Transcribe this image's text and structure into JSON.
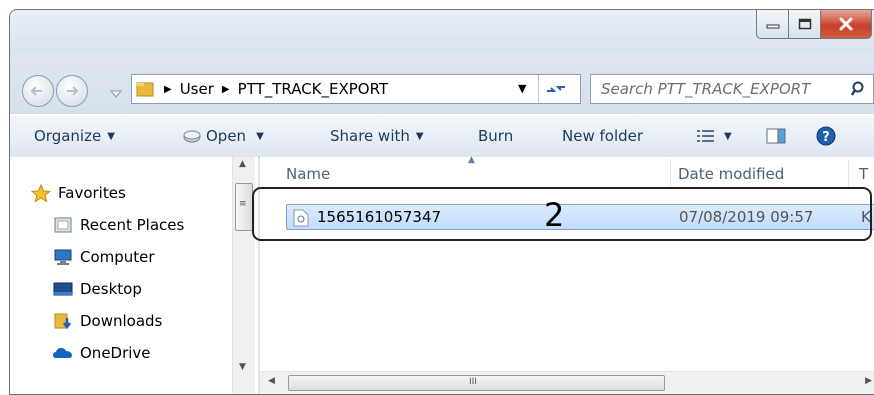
{
  "address": {
    "crumbs": [
      "User",
      "PTT_TRACK_EXPORT"
    ]
  },
  "search": {
    "placeholder": "Search PTT_TRACK_EXPORT"
  },
  "toolbar": {
    "organize": "Organize",
    "open": "Open",
    "share": "Share with",
    "burn": "Burn",
    "new_folder": "New folder"
  },
  "nav": {
    "favorites": "Favorites",
    "items": [
      "Recent Places",
      "Computer",
      "Desktop",
      "Downloads",
      "OneDrive"
    ]
  },
  "columns": {
    "name": "Name",
    "date": "Date modified",
    "type": "T"
  },
  "files": [
    {
      "name": "1565161057347",
      "date": "07/08/2019 09:57",
      "type": "K"
    }
  ],
  "callout": {
    "number": "2"
  },
  "colors": {
    "selection": "#cce4fb",
    "callout_border": "#222222",
    "link_text": "#1e395b"
  },
  "hscroll_glyph": "III"
}
